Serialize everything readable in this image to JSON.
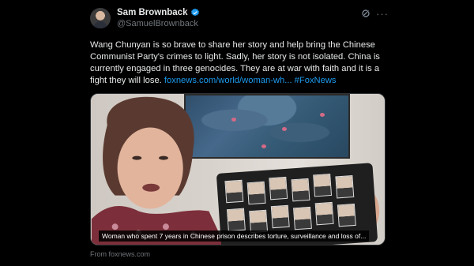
{
  "author": {
    "name": "Sam Brownback",
    "handle": "@SamuelBrownback"
  },
  "post": {
    "text": "Wang Chunyan is so brave to share her story and help bring the Chinese Communist Party's crimes to light. Sadly, her story is not isolated. China is currently engaged in three genocides. They are at war with faith and it is a fight they will lose. ",
    "link": "foxnews.com/world/woman-wh...",
    "hashtag": "#FoxNews"
  },
  "media": {
    "caption": "Woman who spent 7 years in Chinese prison describes torture, surveillance and loss of..."
  },
  "source": "From foxnews.com",
  "icons": {
    "verified": "verified-badge-icon",
    "grok": "grok-icon",
    "more": "more-icon"
  },
  "colors": {
    "link": "#1d9bf0",
    "verified": "#1d9bf0",
    "muted": "#71767b",
    "text": "#e7e9ea"
  }
}
